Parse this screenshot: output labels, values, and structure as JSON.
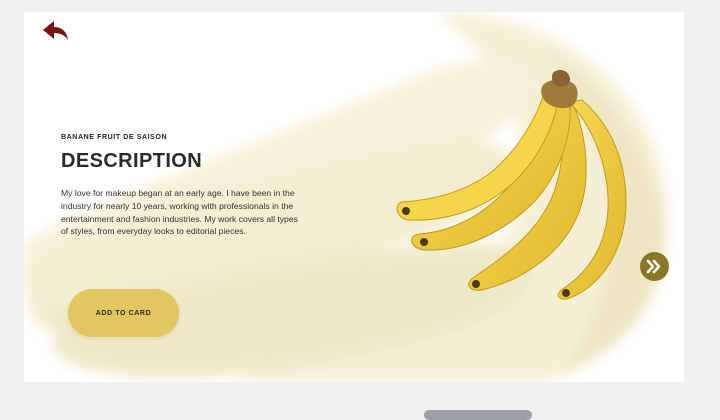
{
  "product": {
    "eyebrow": "BANANE FRUIT DE SAISON",
    "title": "DESCRIPTION",
    "description": "My love for makeup began at an early age. I have been in the industry for nearly 10 years, working with professionals in the entertainment and fashion industries. My work covers all types of styles, from everyday looks to editorial pieces."
  },
  "actions": {
    "add_label": "ADD TO CARD"
  },
  "icons": {
    "back": "back-arrow-icon",
    "next": "double-chevron-right-icon"
  },
  "colors": {
    "accent_button": "#e2c660",
    "next_button": "#8a7627",
    "back_arrow": "#7a1010",
    "banana_yellow": "#f2d03c"
  }
}
